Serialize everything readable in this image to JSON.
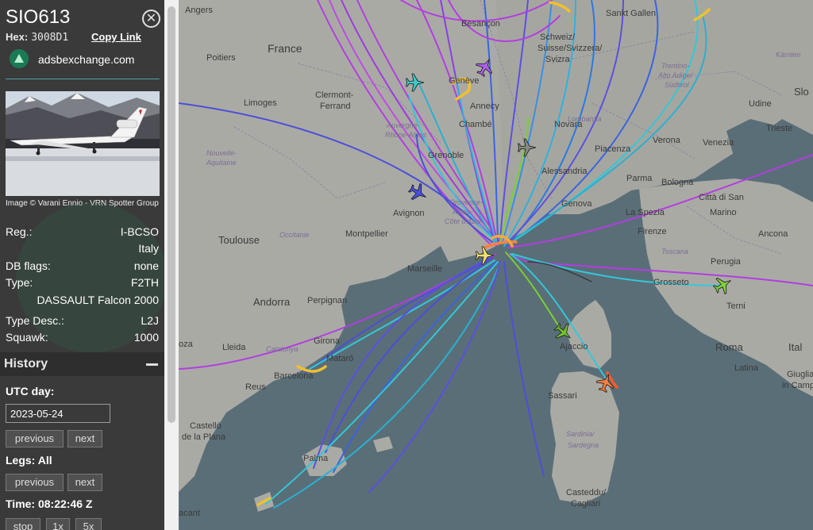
{
  "aircraft": {
    "callsign": "SIO613",
    "hex_label": "Hex:",
    "hex": "3008D1",
    "copy_link": "Copy Link",
    "provider": "adsbexchange.com",
    "photo_credit": "Image © Varani Ennio - VRN Spotter Group",
    "registration_label": "Reg.:",
    "registration": "I-BCSO",
    "country": "Italy",
    "db_flags_label": "DB flags:",
    "db_flags": "none",
    "type_label": "Type:",
    "type_code": "F2TH",
    "type_name": "DASSAULT Falcon 2000",
    "type_desc_label": "Type Desc.:",
    "type_desc": "L2J",
    "squawk_label": "Squawk:",
    "squawk": "1000"
  },
  "history": {
    "title": "History",
    "utc_day_label": "UTC day:",
    "utc_day": "2023-05-24",
    "day_previous": "previous",
    "day_next": "next",
    "legs_label": "Legs: All",
    "legs_previous": "previous",
    "legs_next": "next",
    "time_label": "Time: 08:22:46 Z",
    "stop": "stop",
    "speed_1x": "1x",
    "speed_5x": "5x"
  },
  "map": {
    "labels": {
      "angers": "Angers",
      "poitiers": "Poitiers",
      "france": "France",
      "limoges": "Limoges",
      "clermont": "Clermont-",
      "ferrand": "Ferrand",
      "nouvelle1": "Nouvelle-",
      "nouvelle2": "Aquitaine",
      "auvergne1": "Auvergne-",
      "auvergne2": "Rhône-Alpes",
      "toulouse": "Toulouse",
      "occitanie": "Occitanie",
      "montpellier": "Montpellier",
      "avignon": "Avignon",
      "provence1": "Provence-",
      "provence2": "Alpes-",
      "provence3": "Côte d'Azur",
      "marseille": "Marseille",
      "perpignan": "Perpignan",
      "andorra": "Andorra",
      "lleida": "Lleida",
      "catalunya": "Catalunya",
      "girona": "Girona",
      "mataro": "Mataró",
      "barcelona": "Barcelona",
      "reus": "Reus",
      "castello1": "Castelló",
      "castello2": "de la Plana",
      "palma": "Palma",
      "alacant": "acant",
      "oza": "oza",
      "besancon": "Besançon",
      "schweiz1": "Schweiz/",
      "schweiz2": "Suisse/Svizzera/",
      "schweiz3": "Svizra",
      "sankt": "Sankt Gallen",
      "trentino1": "Trentino-",
      "trentino2": "Alto Adige/",
      "trentino3": "Südtirol",
      "karnten": "Kärnten",
      "slo": "Slo",
      "udine": "Udine",
      "trieste": "Trieste",
      "venezia": "Venezia",
      "verona": "Verona",
      "lombardia": "Lombardia",
      "novara": "Novara",
      "piacenza": "Piacenza",
      "parma": "Parma",
      "bologna": "Bologna",
      "alessandria": "Alessandria",
      "genova": "Genova",
      "laspezia": "La Spezia",
      "chambery": "Chambé",
      "annecy": "Annecy",
      "geneve": "Genève",
      "grenoble": "Grenoble",
      "citta1": "Città di San",
      "citta2": "Marino",
      "firenze": "Firenze",
      "toscana": "Toscana",
      "ancona": "Ancona",
      "perugia": "Perugia",
      "grosseto": "Grosseto",
      "terni": "Terni",
      "roma": "Roma",
      "latina": "Latina",
      "ital": "Ital",
      "giugliano1": "Giuglia",
      "giugliano2": "in Campa",
      "ajaccio": "Ajaccio",
      "sassari": "Sassari",
      "sardinia1": "Sardinia/",
      "sardinia2": "Sardegna",
      "casteddu1": "Casteddu/",
      "casteddu2": "Cagliari"
    }
  },
  "colors": {
    "sea": "#5a6e78",
    "land": "#aaaaa5",
    "sidebar": "#3a3a3a",
    "accent": "#4fa0a4",
    "selected_aircraft": "#ff7f3f",
    "track_purple": "#b23ee0",
    "track_blue": "#4b4fd8",
    "track_cyan": "#32c8d8"
  },
  "icons": [
    "close-icon",
    "adsbx-logo-icon",
    "collapse-icon",
    "aircraft-icon"
  ]
}
